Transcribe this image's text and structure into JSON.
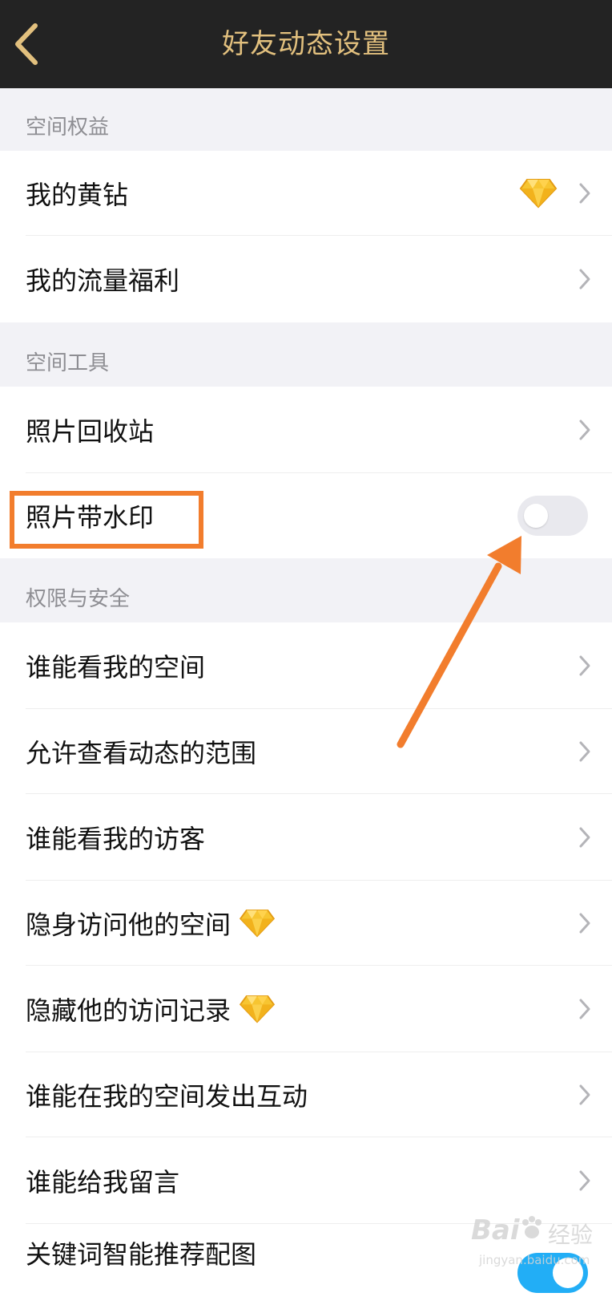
{
  "header": {
    "title": "好友动态设置",
    "back_icon": "chevron-left-icon"
  },
  "sections": [
    {
      "header": "空间权益",
      "items": [
        {
          "label": "我的黄钻",
          "badge": "diamond-icon"
        },
        {
          "label": "我的流量福利"
        }
      ]
    },
    {
      "header": "空间工具",
      "items": [
        {
          "label": "照片回收站"
        },
        {
          "label": "照片带水印",
          "toggle": "off"
        }
      ]
    },
    {
      "header": "权限与安全",
      "items": [
        {
          "label": "谁能看我的空间"
        },
        {
          "label": "允许查看动态的范围"
        },
        {
          "label": "谁能看我的访客"
        },
        {
          "label": "隐身访问他的空间",
          "badge": "diamond-icon"
        },
        {
          "label": "隐藏他的访问记录",
          "badge": "diamond-icon"
        },
        {
          "label": "谁能在我的空间发出互动"
        },
        {
          "label": "谁能给我留言"
        },
        {
          "label": "关键词智能推荐配图",
          "toggle": "on"
        }
      ]
    }
  ],
  "watermark": {
    "logo": "Bai",
    "logo_paw": "paw-icon",
    "logo_cn": "经验",
    "url": "jingyan.baidu.com"
  },
  "colors": {
    "header_bg": "#232323",
    "title": "#e2c07e",
    "annotation": "#f27d2d",
    "toggle_on": "#22aef6"
  }
}
